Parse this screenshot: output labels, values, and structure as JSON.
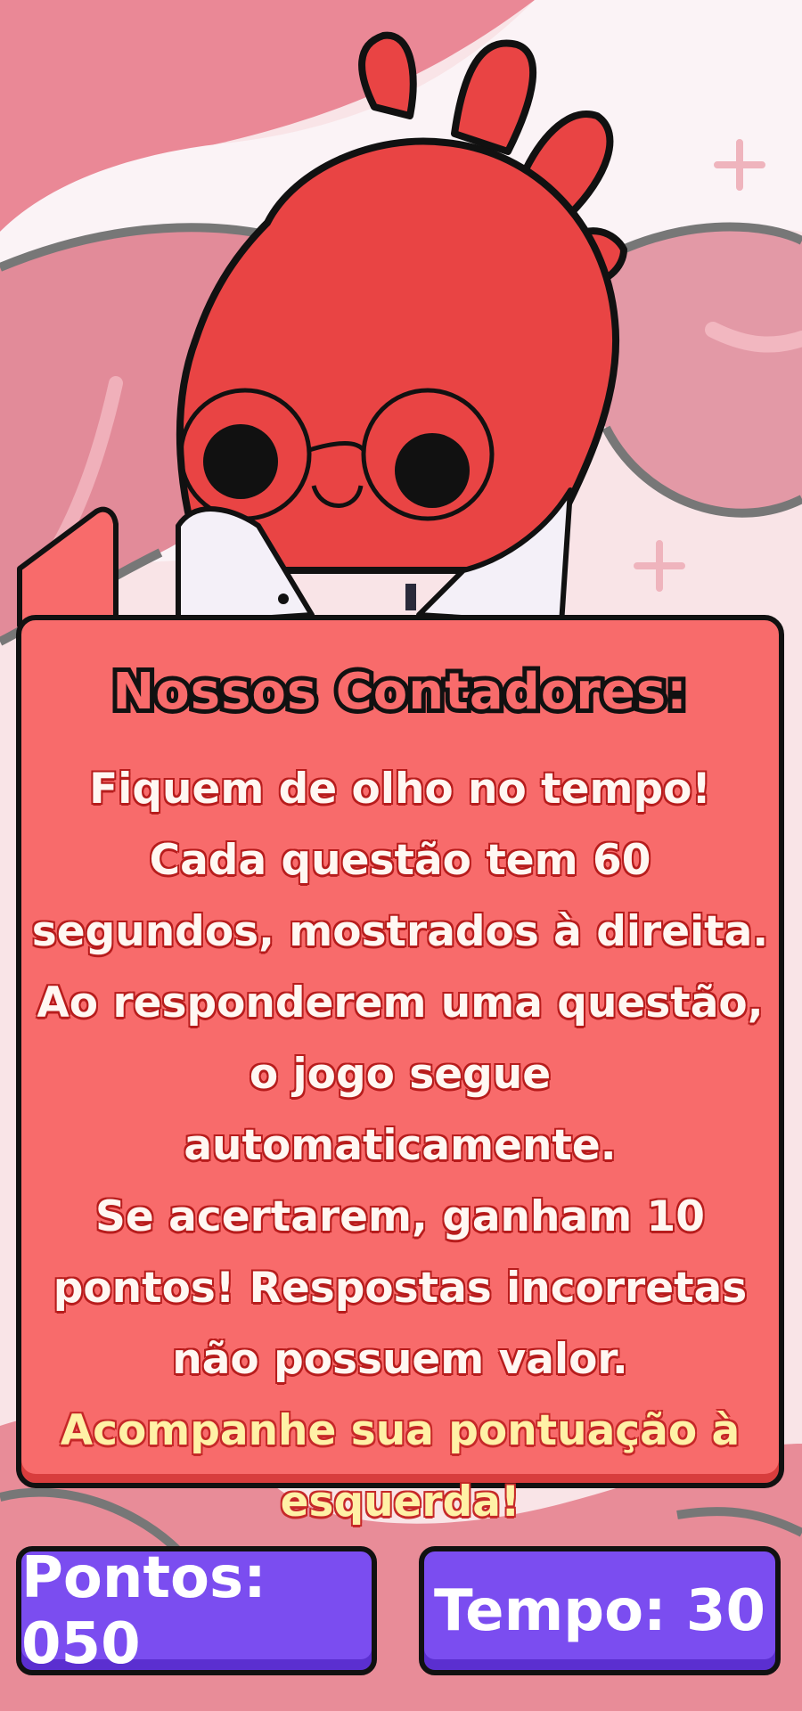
{
  "dialog": {
    "title": "Nossos Contadores:",
    "lines": [
      "Fiquem de olho no tempo! Cada questão tem 60 segundos, mostrados à direita.",
      "Ao responderem uma questão, o jogo segue automaticamente.",
      "Se acertarem, ganham 10 pontos! Respostas incorretas não possuem valor."
    ],
    "highlight": "Acompanhe sua pontuação à esquerda!"
  },
  "hud": {
    "points_label": "Pontos: 050",
    "time_label": "Tempo: 30"
  },
  "character": {
    "name": "heart-doctor-character",
    "colors": {
      "heart": "#e94444",
      "coat": "#f4f0f8",
      "outline": "#111111"
    }
  },
  "colors": {
    "background": "#f7d7dc",
    "panel": "#f86b6b",
    "counter": "#7b4df0",
    "highlight_text": "#fff1a6"
  }
}
